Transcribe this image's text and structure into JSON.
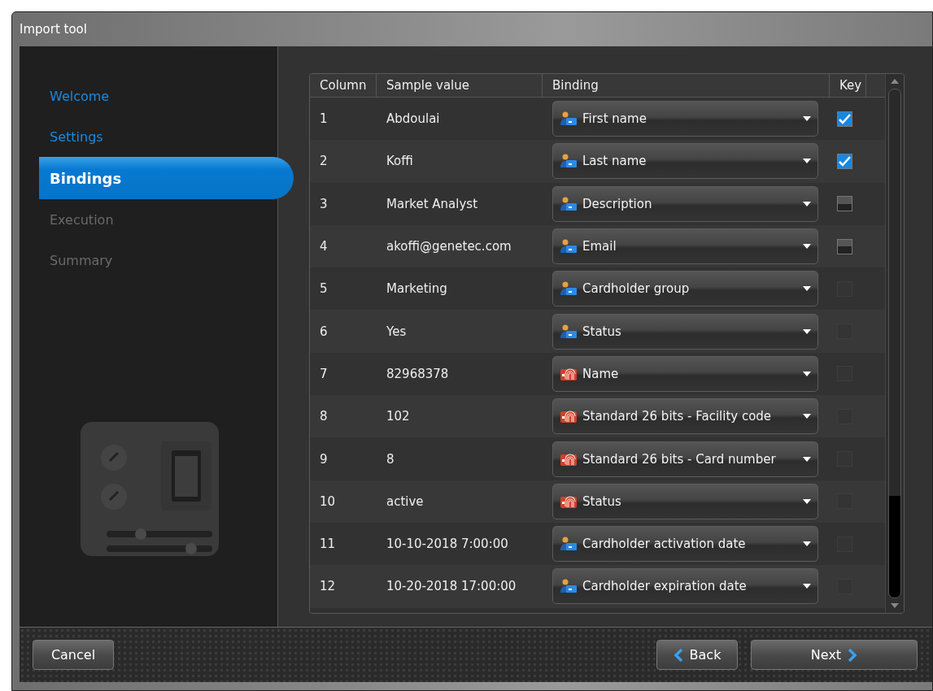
{
  "window": {
    "title": "Import tool"
  },
  "steps": [
    {
      "label": "Welcome",
      "selected": false,
      "disabled": false
    },
    {
      "label": "Settings",
      "selected": false,
      "disabled": false
    },
    {
      "label": "Bindings",
      "selected": true,
      "disabled": false
    },
    {
      "label": "Execution",
      "selected": false,
      "disabled": true
    },
    {
      "label": "Summary",
      "selected": false,
      "disabled": true
    }
  ],
  "table": {
    "columns": [
      "Column",
      "Sample value",
      "Binding",
      "Key"
    ],
    "rows": [
      {
        "column": "1",
        "sample": "Abdoulai",
        "binding": "First name",
        "kind": "cardholder",
        "key": {
          "checked": true,
          "disabled": false
        }
      },
      {
        "column": "2",
        "sample": "Koffi",
        "binding": "Last name",
        "kind": "cardholder",
        "key": {
          "checked": true,
          "disabled": false
        }
      },
      {
        "column": "3",
        "sample": "Market Analyst",
        "binding": "Description",
        "kind": "cardholder",
        "key": {
          "checked": false,
          "disabled": false
        }
      },
      {
        "column": "4",
        "sample": "akoffi@genetec.com",
        "binding": "Email",
        "kind": "cardholder",
        "key": {
          "checked": false,
          "disabled": false
        }
      },
      {
        "column": "5",
        "sample": "Marketing",
        "binding": "Cardholder group",
        "kind": "cardholder",
        "key": {
          "checked": false,
          "disabled": true
        }
      },
      {
        "column": "6",
        "sample": "Yes",
        "binding": "Status",
        "kind": "cardholder",
        "key": {
          "checked": false,
          "disabled": true
        }
      },
      {
        "column": "7",
        "sample": "82968378",
        "binding": "Name",
        "kind": "credential",
        "key": {
          "checked": false,
          "disabled": true
        }
      },
      {
        "column": "8",
        "sample": "102",
        "binding": "Standard 26 bits - Facility code",
        "kind": "credential",
        "key": {
          "checked": false,
          "disabled": true
        }
      },
      {
        "column": "9",
        "sample": "8",
        "binding": "Standard 26 bits - Card number",
        "kind": "credential",
        "key": {
          "checked": false,
          "disabled": true
        }
      },
      {
        "column": "10",
        "sample": "active",
        "binding": "Status",
        "kind": "credential",
        "key": {
          "checked": false,
          "disabled": true
        }
      },
      {
        "column": "11",
        "sample": "10-10-2018 7:00:00",
        "binding": "Cardholder activation date",
        "kind": "cardholder",
        "key": {
          "checked": false,
          "disabled": true
        }
      },
      {
        "column": "12",
        "sample": "10-20-2018 17:00:00",
        "binding": "Cardholder expiration date",
        "kind": "cardholder",
        "key": {
          "checked": false,
          "disabled": true
        }
      }
    ]
  },
  "buttons": {
    "cancel": "Cancel",
    "back": "Back",
    "next": "Next"
  }
}
